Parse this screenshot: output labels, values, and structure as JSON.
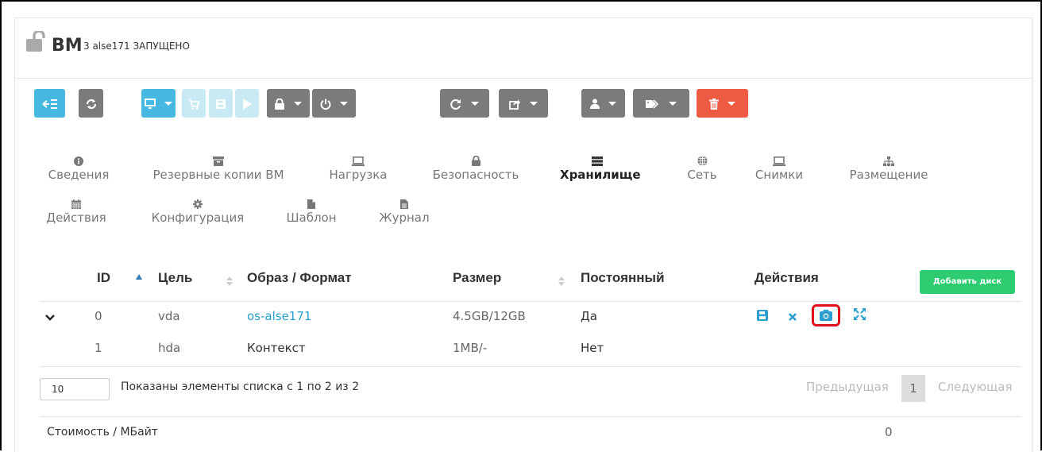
{
  "header": {
    "title": "ВМ",
    "subtitle": "3 alse171 ЗАПУЩЕНО"
  },
  "toolbar": {
    "buttons": [
      {
        "name": "back-to-list",
        "icon": "back-list-icon",
        "color": "#47b8df"
      },
      {
        "name": "refresh",
        "icon": "refresh-icon",
        "color": "#7b7b7b"
      },
      {
        "name": "console",
        "icon": "monitor-icon",
        "color": "#47b8df"
      },
      {
        "name": "deploy",
        "icon": "cart-icon",
        "color": "#c9e9f5"
      },
      {
        "name": "save",
        "icon": "floppy-icon",
        "color": "#c9e9f5"
      },
      {
        "name": "play",
        "icon": "play-icon",
        "color": "#c9e9f5"
      },
      {
        "name": "lock",
        "icon": "lock-icon",
        "color": "#7b7b7b"
      },
      {
        "name": "power",
        "icon": "power-icon",
        "color": "#7b7b7b"
      },
      {
        "name": "reboot",
        "icon": "redo-icon",
        "color": "#7b7b7b"
      },
      {
        "name": "migrate",
        "icon": "share-icon",
        "color": "#7b7b7b"
      },
      {
        "name": "user",
        "icon": "user-icon",
        "color": "#7b7b7b"
      },
      {
        "name": "labels",
        "icon": "tag-icon",
        "color": "#7b7b7b"
      },
      {
        "name": "delete",
        "icon": "trash-icon",
        "color": "#ef5a43"
      }
    ]
  },
  "tabs": [
    {
      "label": "Сведения",
      "icon": "info-icon"
    },
    {
      "label": "Резервные копии ВМ",
      "icon": "archive-icon"
    },
    {
      "label": "Нагрузка",
      "icon": "laptop-icon"
    },
    {
      "label": "Безопасность",
      "icon": "lock-icon"
    },
    {
      "label": "Хранилище",
      "icon": "server-icon",
      "active": true
    },
    {
      "label": "Сеть",
      "icon": "globe-icon"
    },
    {
      "label": "Снимки",
      "icon": "laptop-icon"
    },
    {
      "label": "Размещение",
      "icon": "sitemap-icon"
    },
    {
      "label": "Действия",
      "icon": "calendar-icon"
    },
    {
      "label": "Конфигурация",
      "icon": "gear-icon"
    },
    {
      "label": "Шаблон",
      "icon": "file-icon"
    },
    {
      "label": "Журнал",
      "icon": "file-text-icon"
    }
  ],
  "table": {
    "columns": [
      "ID",
      "Цель",
      "Образ / Формат",
      "Размер",
      "Постоянный",
      "Действия"
    ],
    "add_button": "Добавить диск",
    "rows": [
      {
        "id": "0",
        "target": "vda",
        "image": "os-alse171",
        "size": "4.5GB/12GB",
        "persistent": "Да"
      },
      {
        "id": "1",
        "target": "hda",
        "image": "Контекст",
        "size": "1MB/-",
        "persistent": "Нет"
      }
    ]
  },
  "pagination": {
    "page_size": "10",
    "info": "Показаны элементы списка с 1 по 2 из 2",
    "prev": "Предыдущая",
    "current": "1",
    "next": "Следующая"
  },
  "cost": {
    "label": "Стоимость / МБайт",
    "value": "0"
  },
  "colors": {
    "accent": "#47b8df",
    "danger": "#ef5a43",
    "success": "#2ecc71",
    "highlight": "#e0101a",
    "link": "#2a9fcf"
  }
}
